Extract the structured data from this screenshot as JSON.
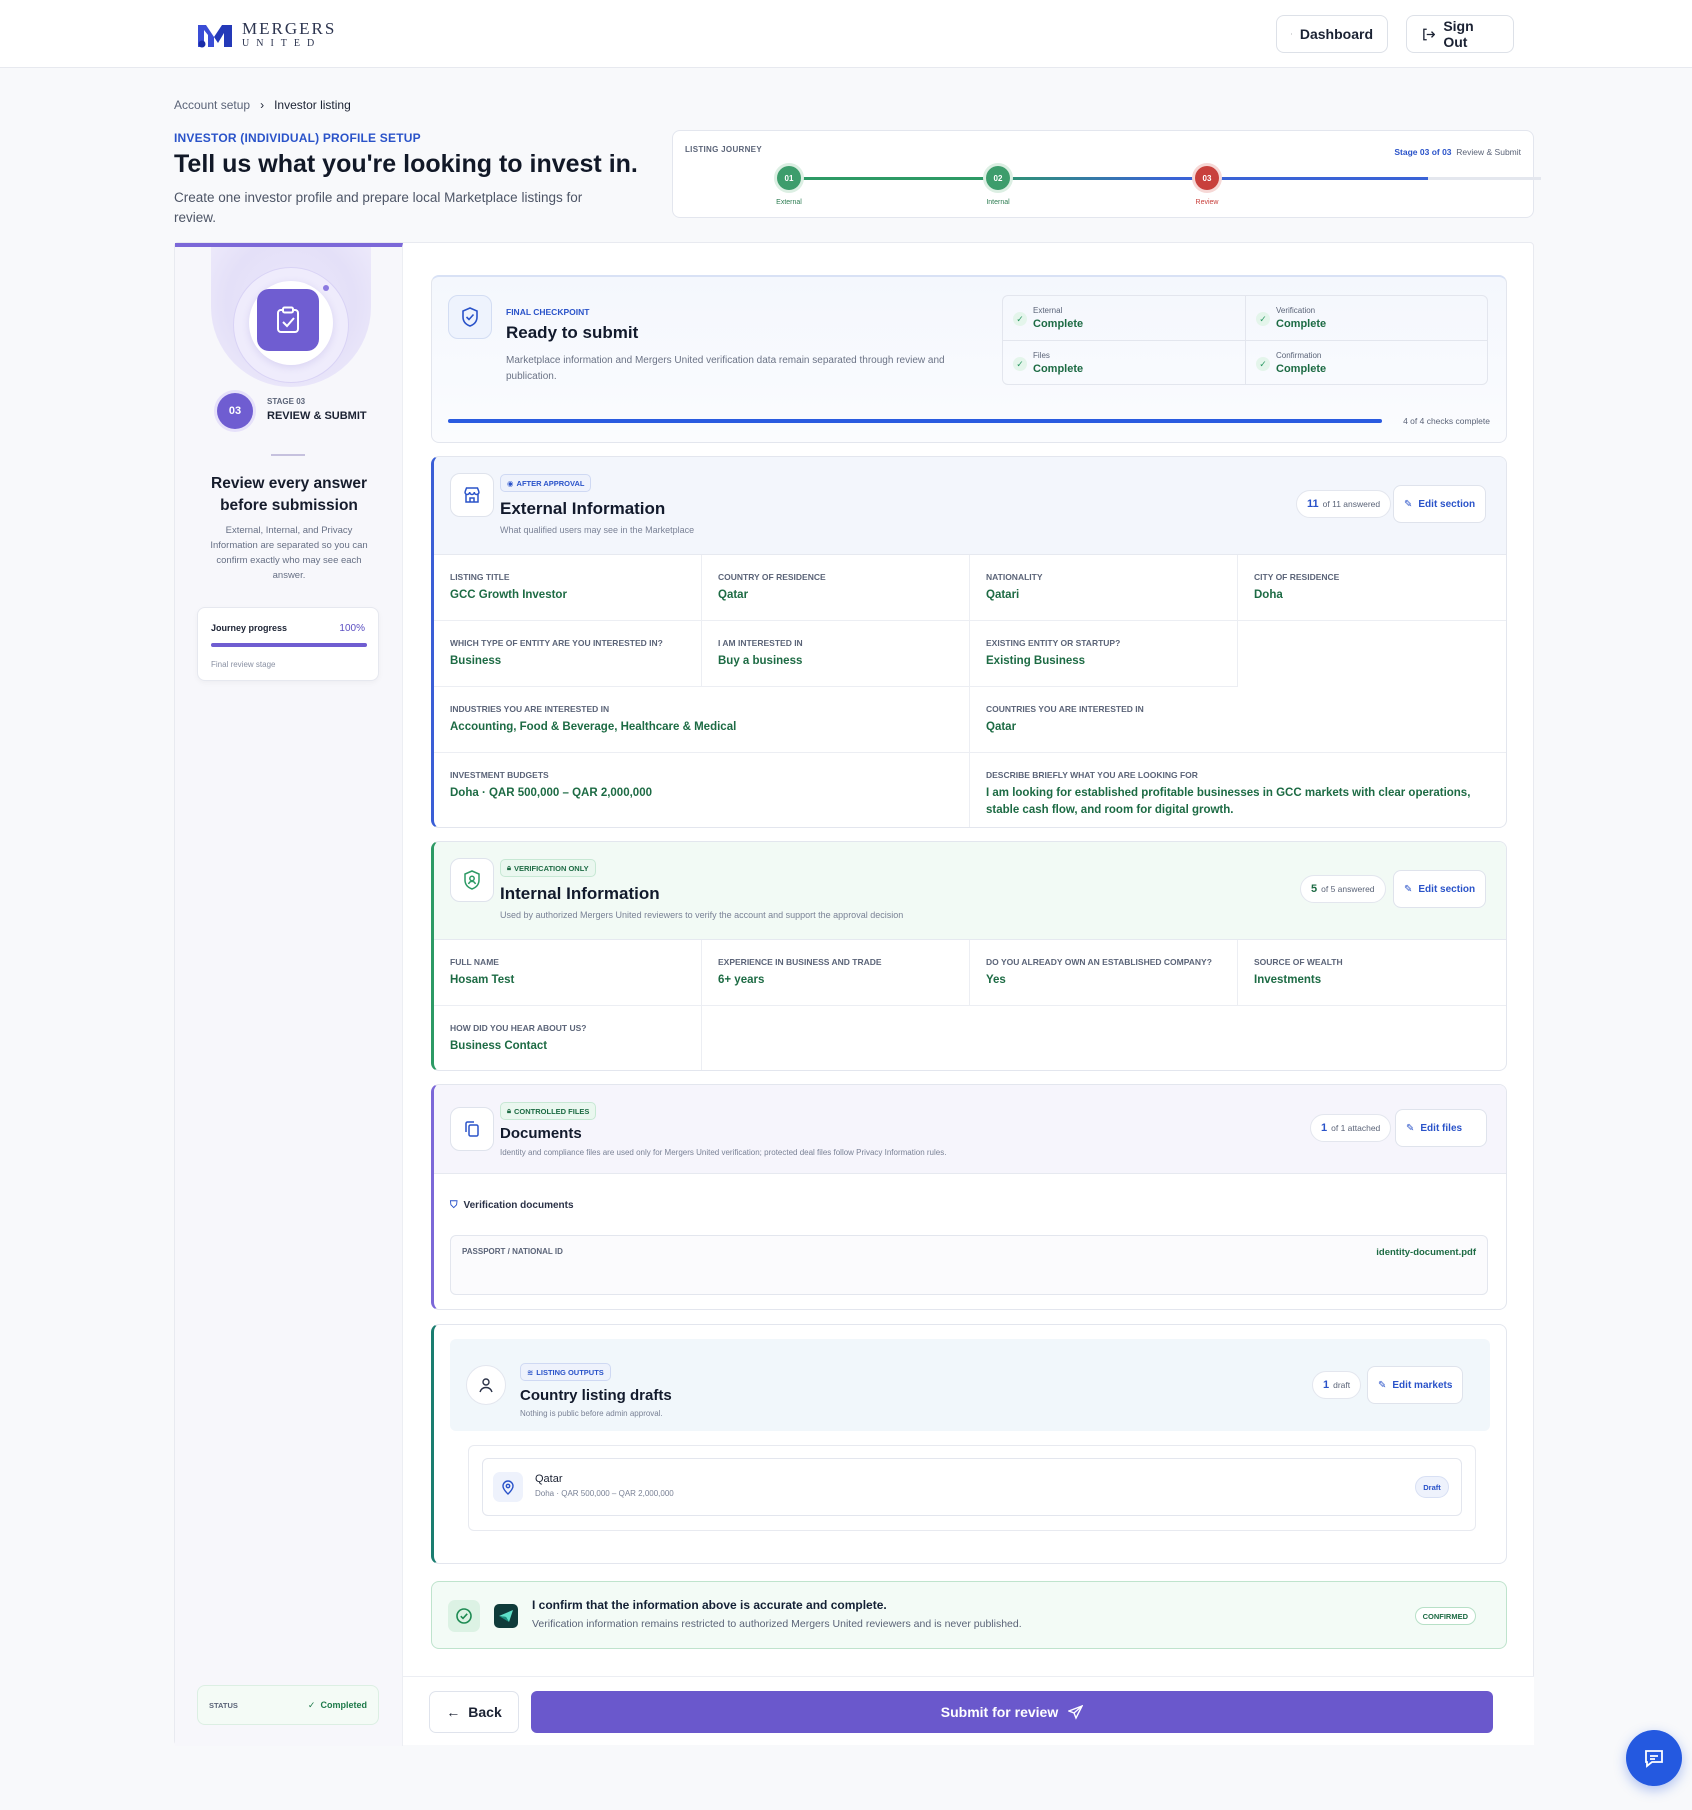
{
  "header": {
    "logo_line1": "MERGERS",
    "logo_line2": "UNITED",
    "dashboard_label": "Dashboard",
    "signout_label": "Sign Out"
  },
  "breadcrumb": {
    "parent": "Account setup",
    "current": "Investor listing"
  },
  "page": {
    "kicker": "INVESTOR (INDIVIDUAL) PROFILE SETUP",
    "title": "Tell us what you're looking to invest in.",
    "subtitle": "Create one investor profile and prepare local Marketplace listings for review."
  },
  "journey": {
    "label": "LISTING JOURNEY",
    "stage_prefix": "Stage 03 of 03",
    "stage_name": "Review & Submit",
    "progress_fraction": 0.85,
    "steps": [
      {
        "num": "01",
        "label": "External",
        "state": "done"
      },
      {
        "num": "02",
        "label": "Internal",
        "state": "done"
      },
      {
        "num": "03",
        "label": "Review",
        "state": "current"
      }
    ]
  },
  "sidebar": {
    "stage_kicker": "STAGE 03",
    "stage_num": "03",
    "stage_title": "REVIEW & SUBMIT",
    "heading": "Review every answer before submission",
    "description": "External, Internal, and Privacy Information are separated so you can confirm exactly who may see each answer.",
    "progress_title": "Journey progress",
    "progress_value": "100%",
    "progress_fraction": 1.0,
    "progress_note": "Final review stage",
    "status_label": "STATUS",
    "status_value": "Completed"
  },
  "ready": {
    "kicker": "FINAL CHECKPOINT",
    "title": "Ready to submit",
    "description": "Marketplace information and Mergers United verification data remain separated through review and publication.",
    "checks": [
      {
        "label": "External",
        "value": "Complete"
      },
      {
        "label": "Verification",
        "value": "Complete"
      },
      {
        "label": "Files",
        "value": "Complete"
      },
      {
        "label": "Confirmation",
        "value": "Complete"
      }
    ],
    "progress_text": "4 of 4 checks complete",
    "progress_fraction": 1.0
  },
  "external": {
    "pill": "AFTER APPROVAL",
    "title": "External Information",
    "subtitle": "What qualified users may see in the Marketplace",
    "count_num": "11",
    "count_text": "of 11 answered",
    "edit_label": "Edit section",
    "fields": [
      {
        "key": "LISTING TITLE",
        "value": "GCC Growth Investor"
      },
      {
        "key": "COUNTRY OF RESIDENCE",
        "value": "Qatar"
      },
      {
        "key": "NATIONALITY",
        "value": "Qatari"
      },
      {
        "key": "CITY OF RESIDENCE",
        "value": "Doha"
      },
      {
        "key": "WHICH TYPE OF ENTITY ARE YOU INTERESTED IN?",
        "value": "Business"
      },
      {
        "key": "I AM INTERESTED IN",
        "value": "Buy a business"
      },
      {
        "key": "EXISTING ENTITY OR STARTUP?",
        "value": "Existing Business"
      },
      {
        "key": "INDUSTRIES YOU ARE INTERESTED IN",
        "value": "Accounting, Food & Beverage, Healthcare & Medical"
      },
      {
        "key": "COUNTRIES YOU ARE INTERESTED IN",
        "value": "Qatar"
      },
      {
        "key": "INVESTMENT BUDGETS",
        "value": "Doha · QAR 500,000 – QAR 2,000,000"
      },
      {
        "key": "DESCRIBE BRIEFLY WHAT YOU ARE LOOKING FOR",
        "value": "I am looking for established profitable businesses in GCC markets with clear operations, stable cash flow, and room for digital growth."
      }
    ]
  },
  "internal": {
    "pill": "VERIFICATION ONLY",
    "title": "Internal Information",
    "subtitle": "Used by authorized Mergers United reviewers to verify the account and support the approval decision",
    "count_num": "5",
    "count_text": "of 5 answered",
    "edit_label": "Edit section",
    "fields": [
      {
        "key": "FULL NAME",
        "value": "Hosam Test"
      },
      {
        "key": "EXPERIENCE IN BUSINESS AND TRADE",
        "value": "6+ years"
      },
      {
        "key": "DO YOU ALREADY OWN AN ESTABLISHED COMPANY?",
        "value": "Yes"
      },
      {
        "key": "SOURCE OF WEALTH",
        "value": "Investments"
      },
      {
        "key": "HOW DID YOU HEAR ABOUT US?",
        "value": "Business Contact"
      }
    ]
  },
  "documents": {
    "pill": "CONTROLLED FILES",
    "title": "Documents",
    "subtitle": "Identity and compliance files are used only for Mergers United verification; protected deal files follow Privacy Information rules.",
    "count_num": "1",
    "count_text": "of 1 attached",
    "edit_label": "Edit files",
    "group_label": "Verification documents",
    "file_key": "PASSPORT / NATIONAL ID",
    "file_name": "identity-document.pdf"
  },
  "drafts": {
    "pill": "LISTING OUTPUTS",
    "title": "Country listing drafts",
    "subtitle": "Nothing is public before admin approval.",
    "count_num": "1",
    "count_text": "draft",
    "edit_label": "Edit markets",
    "item_country": "Qatar",
    "item_detail": "Doha · QAR 500,000 – QAR 2,000,000",
    "item_badge": "Draft"
  },
  "confirm": {
    "title": "I confirm that the information above is accurate and complete.",
    "detail": "Verification information remains restricted to authorized Mergers United reviewers and is never published.",
    "badge": "CONFIRMED"
  },
  "footer": {
    "back_label": "Back",
    "submit_label": "Submit for review"
  },
  "colors": {
    "brand": "#6a58cc",
    "accent_blue": "#2a53c9",
    "success": "#1d6b44"
  }
}
